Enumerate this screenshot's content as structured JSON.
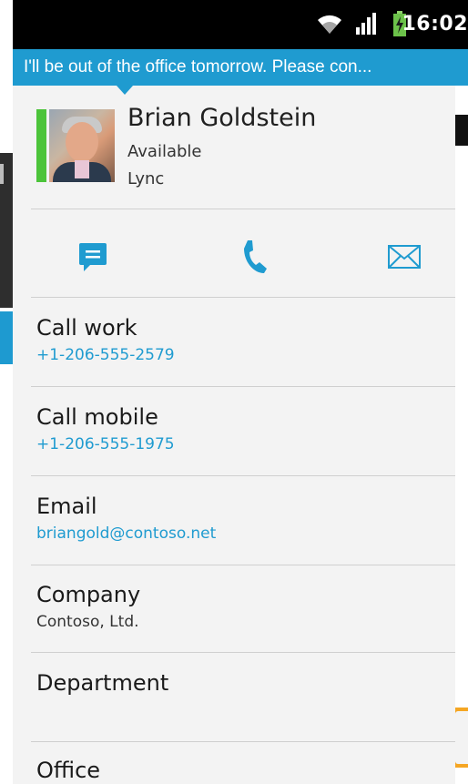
{
  "status_bar": {
    "time": "16:02",
    "icons": [
      "wifi-icon",
      "signal-icon",
      "battery-charging-icon"
    ]
  },
  "status_message": "I'll be out of the office tomorrow. Please con...",
  "contact": {
    "name": "Brian Goldstein",
    "availability": "Available",
    "source": "Lync",
    "presence_color": "#4cc43a"
  },
  "actions": [
    {
      "icon": "message-icon"
    },
    {
      "icon": "phone-icon"
    },
    {
      "icon": "email-icon"
    }
  ],
  "details": [
    {
      "label": "Call work",
      "value": "+1-206-555-2579"
    },
    {
      "label": "Call mobile",
      "value": "+1-206-555-1975"
    },
    {
      "label": "Email",
      "value": "briangold@contoso.net"
    },
    {
      "label": "Company",
      "value": "Contoso, Ltd."
    },
    {
      "label": "Department",
      "value": ""
    },
    {
      "label": "Office",
      "value": ""
    }
  ],
  "colors": {
    "accent": "#1f9bd0",
    "status_bar": "#000000",
    "card_background": "#f3f3f3"
  }
}
